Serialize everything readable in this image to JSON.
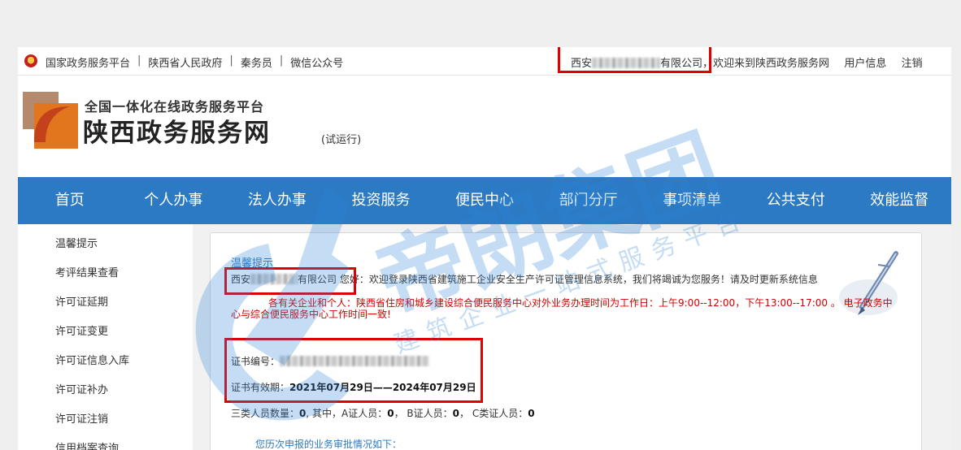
{
  "topbar": {
    "links": [
      "国家政务服务平台",
      "陕西省人民政府",
      "秦务员",
      "微信公众号"
    ],
    "company_prefix": "西安",
    "company_suffix": "有限公司",
    "welcome": "，欢迎来到陕西政务服务网",
    "user_info": "用户信息",
    "logout": "注销"
  },
  "header": {
    "subtitle": "全国一体化在线政务服务平台",
    "title": "陕西政务服务网",
    "trial": "(试运行)"
  },
  "nav": [
    "首页",
    "个人办事",
    "法人办事",
    "投资服务",
    "便民中心",
    "部门分厅",
    "事项清单",
    "公共支付",
    "效能监督"
  ],
  "sidebar": [
    "温馨提示",
    "考评结果查看",
    "许可证延期",
    "许可证变更",
    "许可证信息入库",
    "许可证补办",
    "许可证注销",
    "信用档案查询"
  ],
  "content": {
    "tip_title": "温馨提示",
    "company_prefix": "西安",
    "company_suffix": "有限公司",
    "greeting": "您好：欢迎登录陕西省建筑施工企业安全生产许可证管理信息系统，我们将竭诚为您服务！请及时更新系统信息",
    "notice": "各有关企业和个人：陕西省住房和城乡建设综合便民服务中心对外业务办理时间为工作日：上午9:00--12:00，下午13:00--17:00 。 电子政务中心与综合便民服务中心工作时间一致!",
    "cert_no_label": "证书编号：",
    "cert_valid_label": "证书有效期：",
    "cert_valid_value": "2021年07月29日——2024年07月29日",
    "staff_label": "三类人员数量：",
    "staff_total": "0",
    "staff_mid": ", 其中，A证人员：",
    "staff_a": "0",
    "staff_b_label": "，  B证人员：",
    "staff_b": "0",
    "staff_c_label": "，  C类证人员：",
    "staff_c": "0",
    "history": "您历次申报的业务审批情况如下："
  },
  "watermark": {
    "main": "帝朗集团",
    "sub": "建筑企业一站式服务平台"
  },
  "colors": {
    "nav": "#2c7ac4",
    "highlight": "#e00000",
    "notice": "#d40000"
  }
}
